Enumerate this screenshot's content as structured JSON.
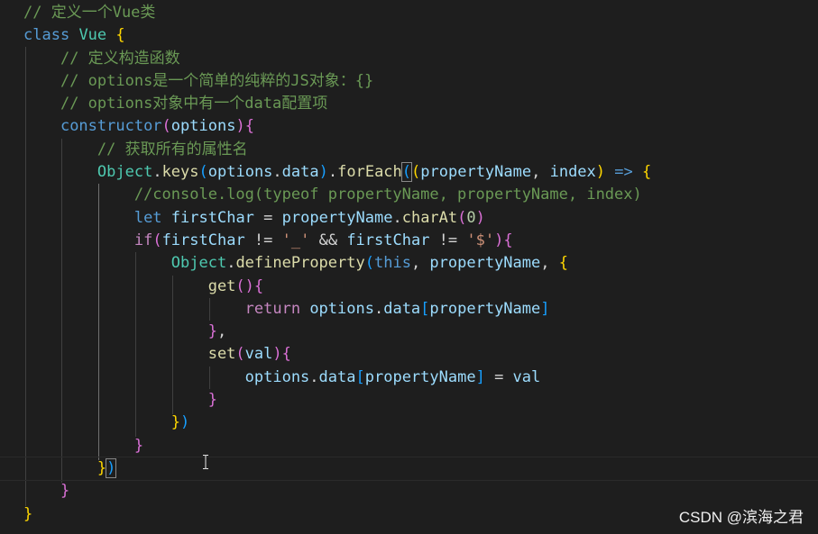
{
  "editor": {
    "language": "javascript",
    "theme": "dark",
    "lines": [
      "// 定义一个Vue类",
      "class Vue {",
      "    // 定义构造函数",
      "    // options是一个简单的纯粹的JS对象：{}",
      "    // options对象中有一个data配置项",
      "    constructor(options){",
      "        // 获取所有的属性名",
      "        Object.keys(options.data).forEach((propertyName, index) => {",
      "            //console.log(typeof propertyName, propertyName, index)",
      "            let firstChar = propertyName.charAt(0)",
      "            if(firstChar != '_' && firstChar != '$'){",
      "                Object.defineProperty(this, propertyName, {",
      "                    get(){",
      "                        return options.data[propertyName]",
      "                    },",
      "                    set(val){",
      "                        options.data[propertyName] = val",
      "                    }",
      "                })",
      "            }",
      "        })",
      "    }",
      "}"
    ],
    "current_line": 21
  },
  "watermark": "CSDN @滨海之君",
  "icons": {
    "text_cursor": "i-beam-cursor-icon"
  },
  "colors": {
    "background": "#1e1e1e",
    "comment": "#6a9955",
    "keyword": "#569cd6",
    "class": "#4ec9b0",
    "function": "#dcdcaa",
    "variable": "#9cdcfe",
    "string": "#ce9178",
    "number": "#b5cea8"
  }
}
